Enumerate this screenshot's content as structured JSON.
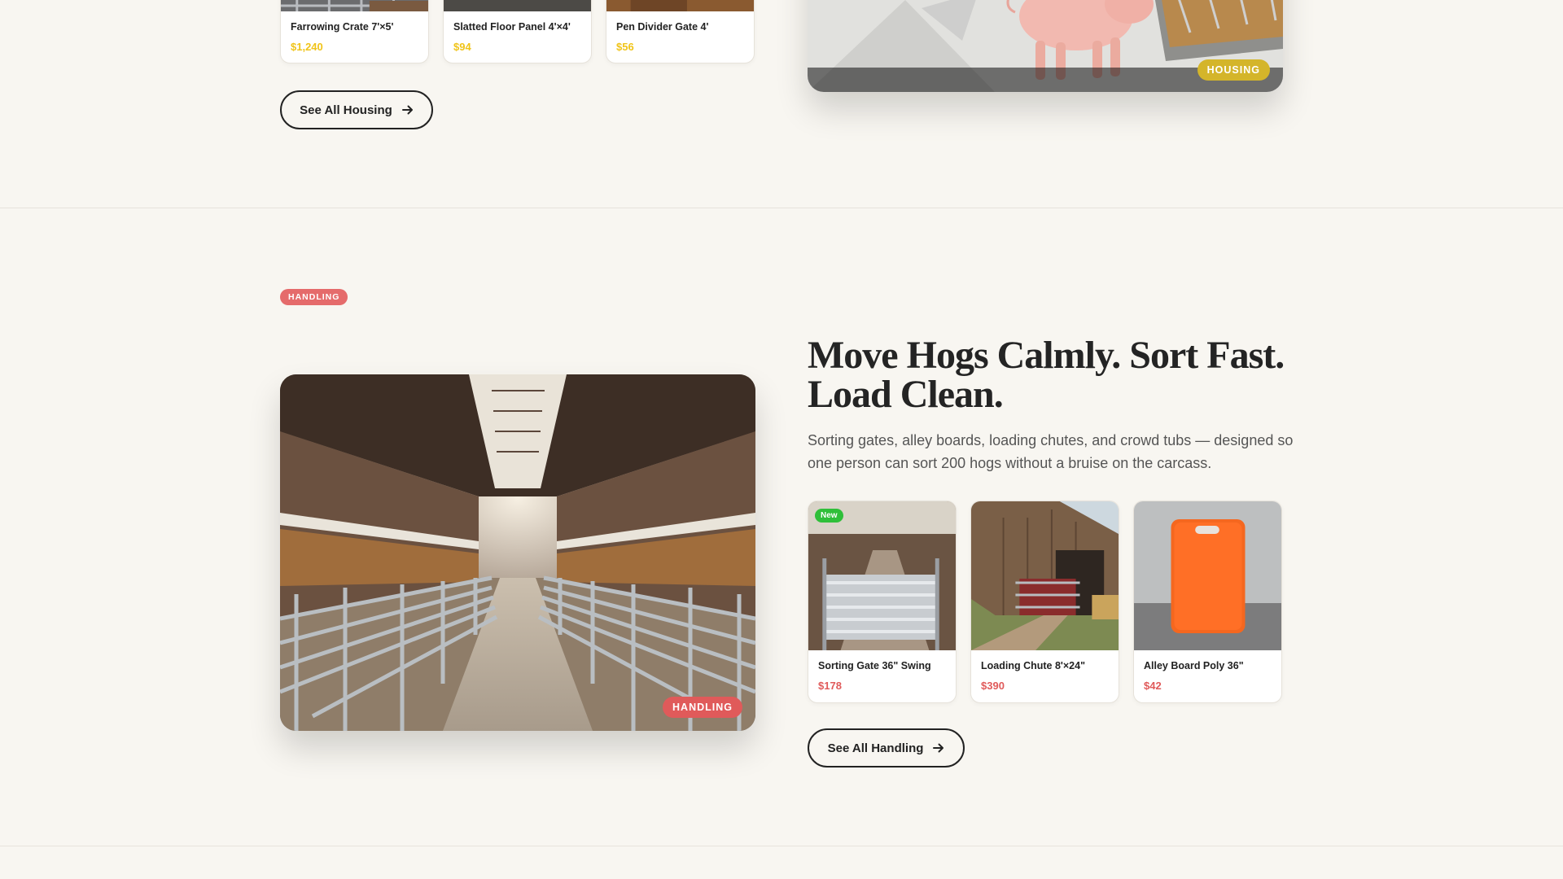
{
  "housing": {
    "products": [
      {
        "name": "Farrowing Crate 7'×5'",
        "price": "$1,240"
      },
      {
        "name": "Slatted Floor Panel 4'×4'",
        "price": "$94"
      },
      {
        "name": "Pen Divider Gate 4'",
        "price": "$56"
      }
    ],
    "see_all_label": "See All Housing",
    "image_tag": "HOUSING",
    "tag_color": "#d4b52a"
  },
  "handling": {
    "section_pill": "HANDLING",
    "headline": "Move Hogs Calmly. Sort Fast. Load Clean.",
    "description": "Sorting gates, alley boards, loading chutes, and crowd tubs — designed so one person can sort 200 hogs without a bruise on the carcass.",
    "image_tag": "HANDLING",
    "tag_color": "#e05a5a",
    "products": [
      {
        "name": "Sorting Gate 36\" Swing",
        "price": "$178",
        "badge": "New"
      },
      {
        "name": "Loading Chute 8'×24\"",
        "price": "$390"
      },
      {
        "name": "Alley Board Poly 36\"",
        "price": "$42"
      }
    ],
    "see_all_label": "See All Handling"
  },
  "icons": {
    "arrow": "arrow-right-icon"
  }
}
